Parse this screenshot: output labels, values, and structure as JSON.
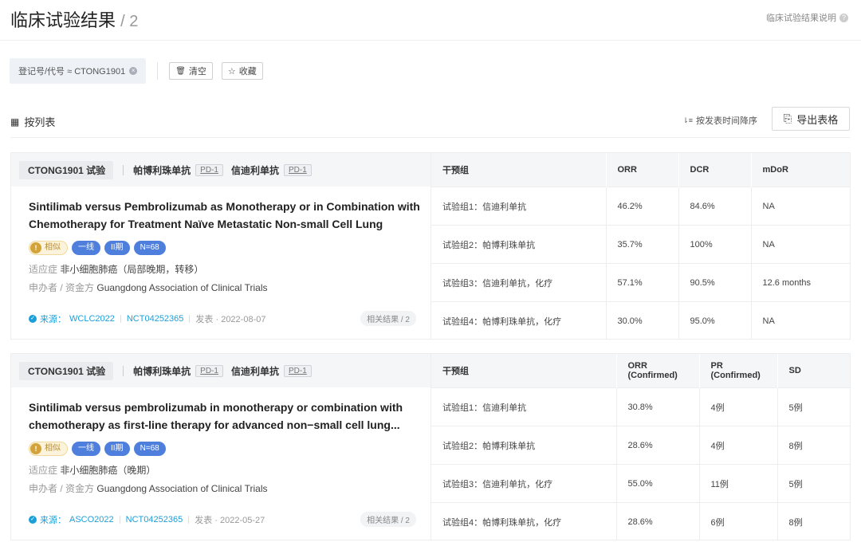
{
  "header": {
    "title": "临床试验结果",
    "count": "/ 2",
    "help_label": "临床试验结果说明",
    "help_icon": "?"
  },
  "filters": {
    "chip_label": "登记号/代号 ≈ CTONG1901",
    "chip_close_icon": "×",
    "clear_label": "清空",
    "clear_icon": "🗑",
    "favorite_label": "收藏",
    "favorite_icon": "☆"
  },
  "view": {
    "list_label": "按列表",
    "list_icon": "▦",
    "sort_label": "按发表时间降序",
    "sort_icon": "⇂≡",
    "export_label": "导出表格",
    "export_icon": "⎘"
  },
  "cards": [
    {
      "trial": "CTONG1901 试验",
      "drugs": [
        {
          "name": "帕博利珠单抗",
          "target": "PD-1"
        },
        {
          "name": "信迪利单抗",
          "target": "PD-1"
        }
      ],
      "title": "Sintilimab versus Pembrolizumab as Monotherapy or in Combination with Chemotherapy for Treatment Naïve Metastatic Non-small Cell Lung Cancer",
      "badges": {
        "similar": "相似",
        "similar_icon": "!",
        "line": "一线",
        "phase": "II期",
        "n": "N=68"
      },
      "indication_key": "适应症",
      "indication": "非小细胞肺癌（局部晚期，转移）",
      "sponsor_key": "申办者 / 资金方",
      "sponsor": "Guangdong Association of Clinical Trials",
      "source_prefix": "来源：",
      "source": "WCLC2022",
      "nct": "NCT04252365",
      "published": "发表 · 2022-08-07",
      "related": "相关结果 / 2",
      "columns": [
        "干预组",
        "ORR",
        "DCR",
        "mDoR"
      ],
      "rows": [
        [
          "试验组1：信迪利单抗",
          "46.2%",
          "84.6%",
          "NA"
        ],
        [
          "试验组2：帕博利珠单抗",
          "35.7%",
          "100%",
          "NA"
        ],
        [
          "试验组3：信迪利单抗，化疗",
          "57.1%",
          "90.5%",
          "12.6 months"
        ],
        [
          "试验组4：帕博利珠单抗，化疗",
          "30.0%",
          "95.0%",
          "NA"
        ]
      ]
    },
    {
      "trial": "CTONG1901 试验",
      "drugs": [
        {
          "name": "帕博利珠单抗",
          "target": "PD-1"
        },
        {
          "name": "信迪利单抗",
          "target": "PD-1"
        }
      ],
      "title": "Sintilimab versus pembrolizumab in monotherapy or combination with chemotherapy as first-line therapy for advanced non−small cell lung...",
      "badges": {
        "similar": "相似",
        "similar_icon": "!",
        "line": "一线",
        "phase": "II期",
        "n": "N=68"
      },
      "indication_key": "适应症",
      "indication": "非小细胞肺癌（晚期）",
      "sponsor_key": "申办者 / 资金方",
      "sponsor": "Guangdong Association of Clinical Trials",
      "source_prefix": "来源：",
      "source": "ASCO2022",
      "nct": "NCT04252365",
      "published": "发表 · 2022-05-27",
      "related": "相关结果 / 2",
      "columns": [
        "干预组",
        "ORR (Confirmed)",
        "PR (Confirmed)",
        "SD"
      ],
      "rows": [
        [
          "试验组1：信迪利单抗",
          "30.8%",
          "4例",
          "5例"
        ],
        [
          "试验组2：帕博利珠单抗",
          "28.6%",
          "4例",
          "8例"
        ],
        [
          "试验组3：信迪利单抗，化疗",
          "55.0%",
          "11例",
          "5例"
        ],
        [
          "试验组4：帕博利珠单抗，化疗",
          "28.6%",
          "6例",
          "8例"
        ]
      ]
    }
  ]
}
